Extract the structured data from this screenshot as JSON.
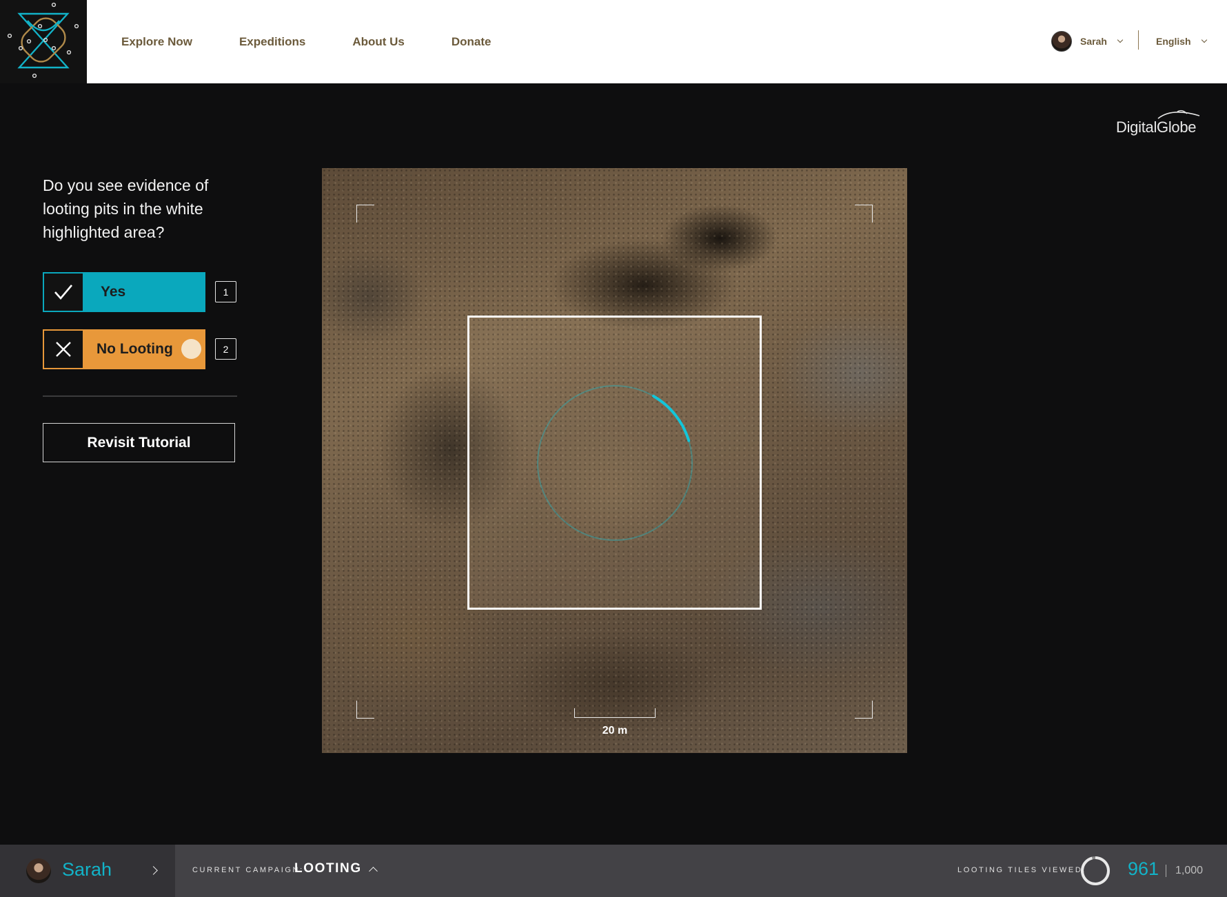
{
  "nav": {
    "items": [
      {
        "label": "Explore Now"
      },
      {
        "label": "Expeditions"
      },
      {
        "label": "About Us"
      },
      {
        "label": "Donate"
      }
    ]
  },
  "header": {
    "user_name": "Sarah",
    "language": "English",
    "logo_icon": "crossed-loops-logo-icon"
  },
  "imagery_provider": "DigitalGlobe",
  "question": {
    "text": "Do you see evidence of looting pits in the white highlighted area?",
    "answers": [
      {
        "label": "Yes",
        "key": "1",
        "icon": "check-icon",
        "color": "#0aa8bd"
      },
      {
        "label": "No Looting",
        "key": "2",
        "icon": "x-icon",
        "color": "#e8983a"
      }
    ],
    "revisit_label": "Revisit Tutorial"
  },
  "satellite": {
    "scale_label": "20 m",
    "timer_progress": 0.12,
    "accent": "#12c6da"
  },
  "footer": {
    "user_name": "Sarah",
    "campaign_label": "CURRENT CAMPAIGN:",
    "campaign_value": "LOOTING",
    "tiles_label": "LOOTING TILES VIEWED:",
    "tiles_viewed": "961",
    "tiles_total": "1,000",
    "tiles_progress": 0.961
  }
}
